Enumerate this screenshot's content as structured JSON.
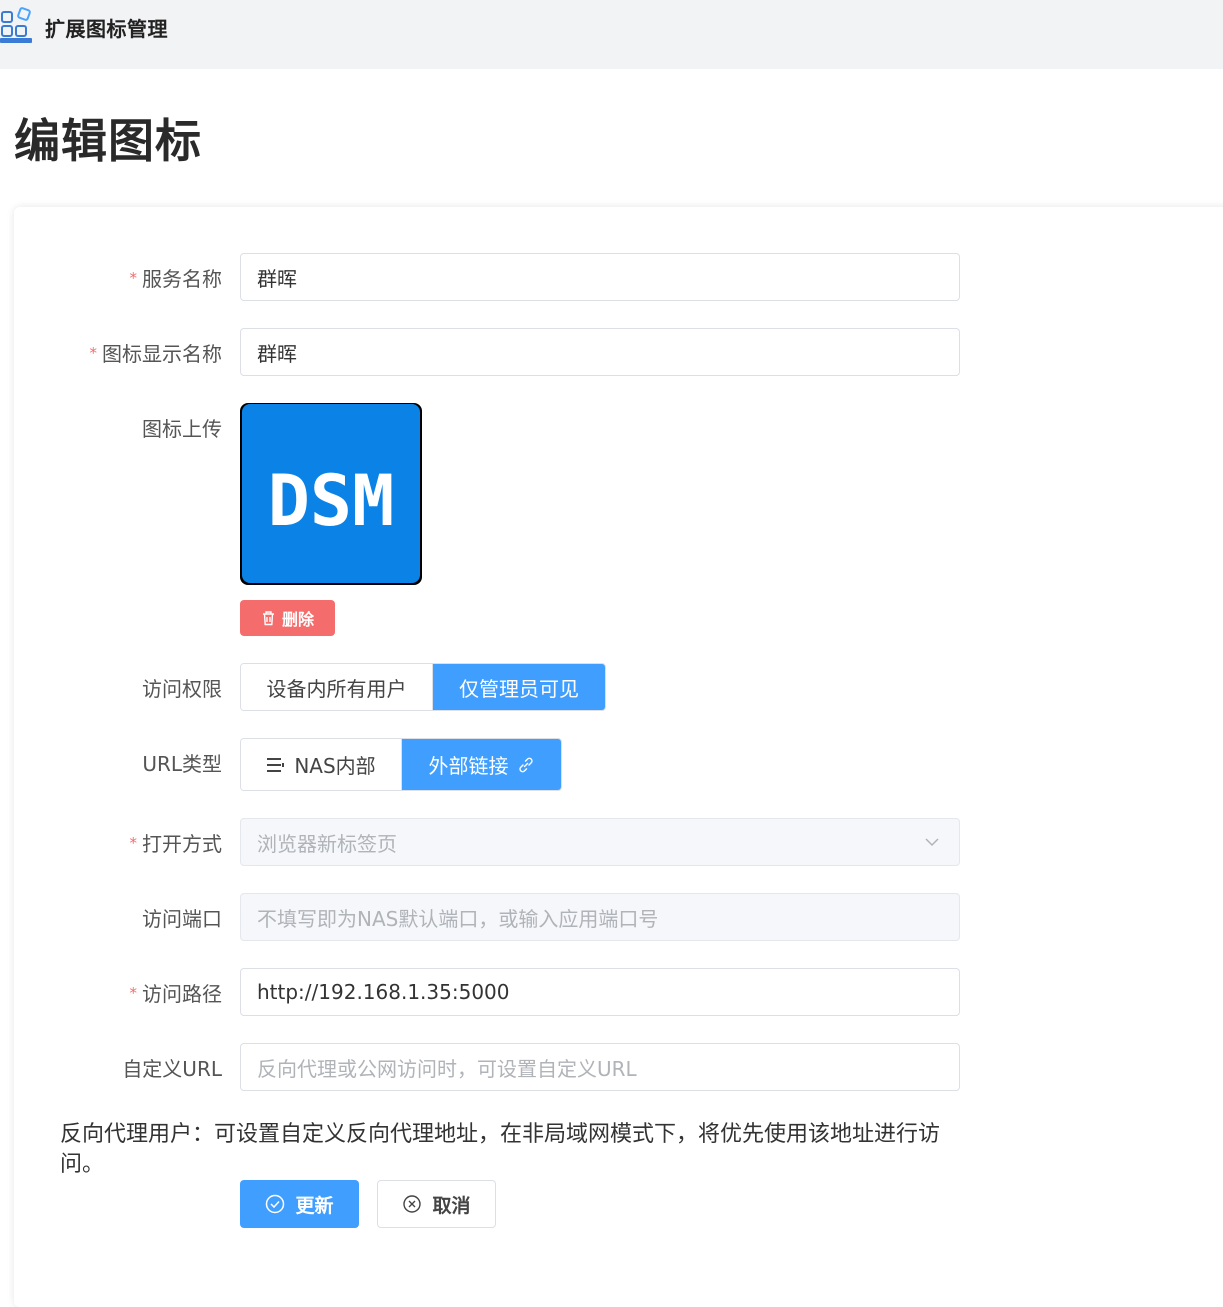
{
  "app": {
    "title": "扩展图标管理",
    "logo_icon": "grid-apps-icon"
  },
  "page": {
    "title": "编辑图标"
  },
  "form": {
    "required_mark": "*",
    "service_name": {
      "label": "服务名称",
      "value": "群晖"
    },
    "display_name": {
      "label": "图标显示名称",
      "value": "群晖"
    },
    "icon_upload": {
      "label": "图标上传",
      "image_text": "DSM",
      "delete_label": "删除",
      "image_color": "#0a82e6"
    },
    "access": {
      "label": "访问权限",
      "options": [
        "设备内所有用户",
        "仅管理员可见"
      ],
      "selected": "仅管理员可见"
    },
    "url_type": {
      "label": "URL类型",
      "options": [
        "NAS内部",
        "外部链接"
      ],
      "selected": "外部链接"
    },
    "open_mode": {
      "label": "打开方式",
      "value": "浏览器新标签页"
    },
    "port": {
      "label": "访问端口",
      "placeholder": "不填写即为NAS默认端口，或输入应用端口号"
    },
    "path": {
      "label": "访问路径",
      "value": "http://192.168.1.35:5000"
    },
    "custom_url": {
      "label": "自定义URL",
      "placeholder": "反向代理或公网访问时，可设置自定义URL"
    },
    "note": "反向代理用户：可设置自定义反向代理地址，在非局域网模式下，将优先使用该地址进行访问。",
    "submit_label": "更新",
    "cancel_label": "取消"
  },
  "colors": {
    "primary": "#409eff",
    "danger": "#f56c6c",
    "required": "#f56c6c"
  }
}
